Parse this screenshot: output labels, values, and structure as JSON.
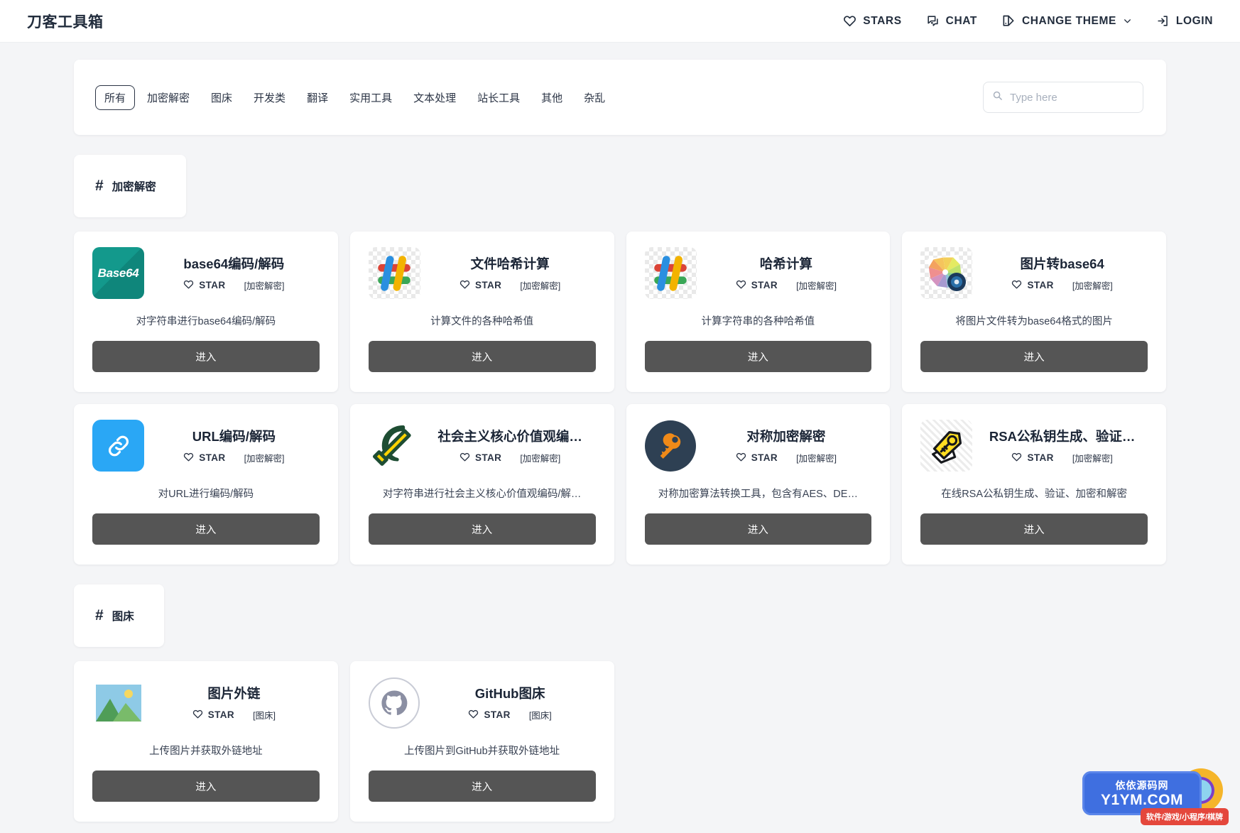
{
  "header": {
    "brand": "刀客工具箱",
    "nav": [
      {
        "id": "stars",
        "label": "STARS",
        "icon": "heart-icon"
      },
      {
        "id": "chat",
        "label": "CHAT",
        "icon": "chat-bubble-icon"
      },
      {
        "id": "theme",
        "label": "CHANGE THEME",
        "icon": "theme-palette-icon",
        "caret": true
      },
      {
        "id": "login",
        "label": "LOGIN",
        "icon": "login-arrow-icon"
      }
    ]
  },
  "filters": {
    "tabs": [
      {
        "label": "所有",
        "active": true
      },
      {
        "label": "加密解密",
        "active": false
      },
      {
        "label": "图床",
        "active": false
      },
      {
        "label": "开发类",
        "active": false
      },
      {
        "label": "翻译",
        "active": false
      },
      {
        "label": "实用工具",
        "active": false
      },
      {
        "label": "文本处理",
        "active": false
      },
      {
        "label": "站长工具",
        "active": false
      },
      {
        "label": "其他",
        "active": false
      },
      {
        "label": "杂乱",
        "active": false
      }
    ],
    "search": {
      "value": "",
      "placeholder": "Type here",
      "icon": "search-icon"
    }
  },
  "labels": {
    "star": "STAR",
    "enter": "进入",
    "hash": "#"
  },
  "sections": [
    {
      "id": "encrypt",
      "title": "加密解密",
      "cards": [
        {
          "title": "base64编码/解码",
          "star": "STAR",
          "category": "[加密解密]",
          "desc": "对字符串进行base64编码/解码",
          "button": "进入",
          "icon": "base64-icon",
          "icon_text": "Base64",
          "icon_color": "#13998c"
        },
        {
          "title": "文件哈希计算",
          "star": "STAR",
          "category": "[加密解密]",
          "desc": "计算文件的各种哈希值",
          "button": "进入",
          "icon": "hash-slack-icon",
          "icon_color": "#db4437"
        },
        {
          "title": "哈希计算",
          "star": "STAR",
          "category": "[加密解密]",
          "desc": "计算字符串的各种哈希值",
          "button": "进入",
          "icon": "hash-slack-icon",
          "icon_color": "#db4437"
        },
        {
          "title": "图片转base64",
          "star": "STAR",
          "category": "[加密解密]",
          "desc": "将图片文件转为base64格式的图片",
          "button": "进入",
          "icon": "color-wheel-photo-icon",
          "icon_color": "#1b3a5c"
        },
        {
          "title": "URL编码/解码",
          "star": "STAR",
          "category": "[加密解密]",
          "desc": "对URL进行编码/解码",
          "button": "进入",
          "icon": "link-chain-icon",
          "icon_color": "#2aa7f5"
        },
        {
          "title": "社会主义核心价值观编…",
          "star": "STAR",
          "category": "[加密解密]",
          "desc": "对字符串进行社会主义核心价值观编码/解…",
          "button": "进入",
          "icon": "hammer-sickle-icon",
          "icon_color": "#fbd302"
        },
        {
          "title": "对称加密解密",
          "star": "STAR",
          "category": "[加密解密]",
          "desc": "对称加密算法转换工具，包含有AES、DE…",
          "button": "进入",
          "icon": "key-circle-icon",
          "icon_color": "#2e4053"
        },
        {
          "title": "RSA公私钥生成、验证…",
          "star": "STAR",
          "category": "[加密解密]",
          "desc": "在线RSA公私钥生成、验证、加密和解密",
          "button": "进入",
          "icon": "key-tag-icon",
          "icon_color": "#ffdd22"
        }
      ]
    },
    {
      "id": "imagehost",
      "title": "图床",
      "cards": [
        {
          "title": "图片外链",
          "star": "STAR",
          "category": "[图床]",
          "desc": "上传图片并获取外链地址",
          "button": "进入",
          "icon": "picture-mountain-icon",
          "icon_color": "#8ecae6"
        },
        {
          "title": "GitHub图床",
          "star": "STAR",
          "category": "[图床]",
          "desc": "上传图片到GitHub并获取外链地址",
          "button": "进入",
          "icon": "github-octocat-icon",
          "icon_color": "#8b8fa3"
        }
      ]
    }
  ],
  "watermark": {
    "cn": "依依源码网",
    "en": "Y1YM.COM",
    "tag": "软件/游戏/小程序/棋牌"
  }
}
